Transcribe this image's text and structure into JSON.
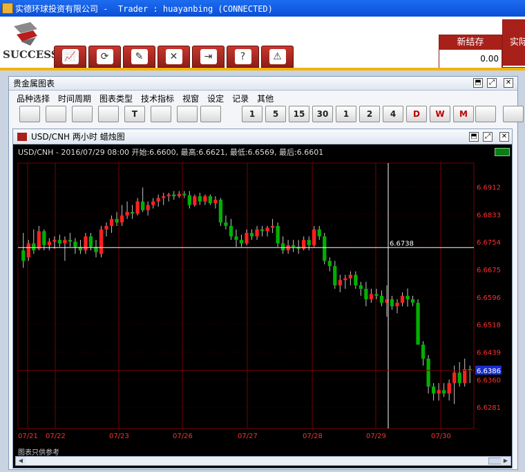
{
  "window": {
    "title": "实德环球投资有限公司 -  Trader : huayanbing (CONNECTED)"
  },
  "logo": {
    "text": "SUCCESS"
  },
  "top_toolbar": [
    {
      "icon": "chart-icon"
    },
    {
      "icon": "refresh-icon"
    },
    {
      "icon": "order-icon"
    },
    {
      "icon": "tools-icon"
    },
    {
      "icon": "logout-icon"
    },
    {
      "icon": "help-icon"
    },
    {
      "icon": "alert-icon"
    }
  ],
  "stats": [
    {
      "label": "新结存",
      "value": "0.00"
    },
    {
      "label": "实际",
      "value": ""
    }
  ],
  "outer_panel": {
    "title": "贵金属图表"
  },
  "menu": [
    "品种选择",
    "时间周期",
    "图表类型",
    "技术指标",
    "视窗",
    "设定",
    "记录",
    "其他"
  ],
  "chart_toolbar": [
    "",
    "",
    "",
    "",
    "T",
    "",
    "",
    "",
    "1",
    "5",
    "15",
    "30",
    "1",
    "2",
    "4",
    "D",
    "W",
    "M",
    "",
    ""
  ],
  "inner_panel": {
    "title": "USD/CNH 两小时 蜡烛图"
  },
  "info_line": "USD/CNH - 2016/07/29 08:00 开始:6.6600, 最高:6.6621, 最低:6.6569, 最后:6.6601",
  "footer": "图表只供参考",
  "chart_data": {
    "type": "candlestick",
    "symbol": "USD/CNH",
    "interval": "两小时",
    "x_labels": [
      "07/21",
      "07/22",
      "07/23",
      "07/26",
      "07/27",
      "07/28",
      "07/29",
      "07/30"
    ],
    "y_ticks": [
      "6.6912",
      "6.6833",
      "6.6754",
      "6.6675",
      "6.6596",
      "6.6518",
      "6.6439",
      "6.6360",
      "6.6281"
    ],
    "ylim": [
      6.622,
      6.698
    ],
    "crosshair_value": "6.6738",
    "last_price": "6.6386",
    "colors": {
      "up": "#ff2020",
      "down": "#00b000",
      "background": "#000000",
      "grid": "#7a0000",
      "axis_text": "#ff3030"
    },
    "candles": [
      {
        "o": 6.673,
        "h": 6.678,
        "l": 6.668,
        "c": 6.67
      },
      {
        "o": 6.671,
        "h": 6.676,
        "l": 6.67,
        "c": 6.675
      },
      {
        "o": 6.675,
        "h": 6.679,
        "l": 6.672,
        "c": 6.673
      },
      {
        "o": 6.6735,
        "h": 6.68,
        "l": 6.673,
        "c": 6.6785
      },
      {
        "o": 6.6785,
        "h": 6.679,
        "l": 6.673,
        "c": 6.6745
      },
      {
        "o": 6.6745,
        "h": 6.6765,
        "l": 6.673,
        "c": 6.6755
      },
      {
        "o": 6.6755,
        "h": 6.677,
        "l": 6.6735,
        "c": 6.676
      },
      {
        "o": 6.676,
        "h": 6.6775,
        "l": 6.674,
        "c": 6.675
      },
      {
        "o": 6.675,
        "h": 6.677,
        "l": 6.67,
        "c": 6.676
      },
      {
        "o": 6.676,
        "h": 6.678,
        "l": 6.674,
        "c": 6.6755
      },
      {
        "o": 6.6755,
        "h": 6.6765,
        "l": 6.672,
        "c": 6.674
      },
      {
        "o": 6.674,
        "h": 6.676,
        "l": 6.672,
        "c": 6.673
      },
      {
        "o": 6.673,
        "h": 6.678,
        "l": 6.672,
        "c": 6.677
      },
      {
        "o": 6.677,
        "h": 6.678,
        "l": 6.673,
        "c": 6.674
      },
      {
        "o": 6.674,
        "h": 6.676,
        "l": 6.671,
        "c": 6.6725
      },
      {
        "o": 6.672,
        "h": 6.68,
        "l": 6.671,
        "c": 6.679
      },
      {
        "o": 6.679,
        "h": 6.681,
        "l": 6.677,
        "c": 6.68
      },
      {
        "o": 6.68,
        "h": 6.683,
        "l": 6.678,
        "c": 6.682
      },
      {
        "o": 6.682,
        "h": 6.684,
        "l": 6.68,
        "c": 6.681
      },
      {
        "o": 6.681,
        "h": 6.686,
        "l": 6.68,
        "c": 6.683
      },
      {
        "o": 6.683,
        "h": 6.687,
        "l": 6.682,
        "c": 6.684
      },
      {
        "o": 6.684,
        "h": 6.686,
        "l": 6.682,
        "c": 6.6835
      },
      {
        "o": 6.6835,
        "h": 6.688,
        "l": 6.683,
        "c": 6.687
      },
      {
        "o": 6.687,
        "h": 6.691,
        "l": 6.684,
        "c": 6.6845
      },
      {
        "o": 6.6845,
        "h": 6.687,
        "l": 6.683,
        "c": 6.686
      },
      {
        "o": 6.686,
        "h": 6.688,
        "l": 6.685,
        "c": 6.687
      },
      {
        "o": 6.687,
        "h": 6.689,
        "l": 6.6855,
        "c": 6.688
      },
      {
        "o": 6.688,
        "h": 6.6895,
        "l": 6.686,
        "c": 6.6885
      },
      {
        "o": 6.6885,
        "h": 6.6895,
        "l": 6.687,
        "c": 6.689
      },
      {
        "o": 6.689,
        "h": 6.69,
        "l": 6.6875,
        "c": 6.6885
      },
      {
        "o": 6.6885,
        "h": 6.69,
        "l": 6.688,
        "c": 6.6892
      },
      {
        "o": 6.6892,
        "h": 6.69,
        "l": 6.688,
        "c": 6.6888
      },
      {
        "o": 6.6888,
        "h": 6.69,
        "l": 6.685,
        "c": 6.686
      },
      {
        "o": 6.686,
        "h": 6.689,
        "l": 6.6855,
        "c": 6.6885
      },
      {
        "o": 6.6885,
        "h": 6.6895,
        "l": 6.686,
        "c": 6.687
      },
      {
        "o": 6.687,
        "h": 6.689,
        "l": 6.686,
        "c": 6.6885
      },
      {
        "o": 6.6885,
        "h": 6.689,
        "l": 6.686,
        "c": 6.6865
      },
      {
        "o": 6.6865,
        "h": 6.6885,
        "l": 6.685,
        "c": 6.6875
      },
      {
        "o": 6.6875,
        "h": 6.688,
        "l": 6.68,
        "c": 6.681
      },
      {
        "o": 6.681,
        "h": 6.683,
        "l": 6.679,
        "c": 6.68
      },
      {
        "o": 6.68,
        "h": 6.682,
        "l": 6.676,
        "c": 6.677
      },
      {
        "o": 6.677,
        "h": 6.679,
        "l": 6.674,
        "c": 6.676
      },
      {
        "o": 6.676,
        "h": 6.6775,
        "l": 6.674,
        "c": 6.675
      },
      {
        "o": 6.675,
        "h": 6.679,
        "l": 6.6745,
        "c": 6.678
      },
      {
        "o": 6.678,
        "h": 6.679,
        "l": 6.676,
        "c": 6.677
      },
      {
        "o": 6.677,
        "h": 6.68,
        "l": 6.676,
        "c": 6.679
      },
      {
        "o": 6.679,
        "h": 6.68,
        "l": 6.677,
        "c": 6.6785
      },
      {
        "o": 6.6785,
        "h": 6.68,
        "l": 6.677,
        "c": 6.6795
      },
      {
        "o": 6.6795,
        "h": 6.682,
        "l": 6.678,
        "c": 6.68
      },
      {
        "o": 6.68,
        "h": 6.681,
        "l": 6.674,
        "c": 6.675
      },
      {
        "o": 6.675,
        "h": 6.677,
        "l": 6.672,
        "c": 6.673
      },
      {
        "o": 6.673,
        "h": 6.676,
        "l": 6.672,
        "c": 6.6745
      },
      {
        "o": 6.6745,
        "h": 6.676,
        "l": 6.6725,
        "c": 6.674
      },
      {
        "o": 6.674,
        "h": 6.676,
        "l": 6.672,
        "c": 6.6735
      },
      {
        "o": 6.6735,
        "h": 6.677,
        "l": 6.673,
        "c": 6.676
      },
      {
        "o": 6.676,
        "h": 6.677,
        "l": 6.673,
        "c": 6.6745
      },
      {
        "o": 6.6745,
        "h": 6.68,
        "l": 6.674,
        "c": 6.679
      },
      {
        "o": 6.679,
        "h": 6.68,
        "l": 6.676,
        "c": 6.677
      },
      {
        "o": 6.677,
        "h": 6.678,
        "l": 6.669,
        "c": 6.67
      },
      {
        "o": 6.67,
        "h": 6.671,
        "l": 6.667,
        "c": 6.6685
      },
      {
        "o": 6.6685,
        "h": 6.67,
        "l": 6.662,
        "c": 6.663
      },
      {
        "o": 6.663,
        "h": 6.666,
        "l": 6.661,
        "c": 6.6645
      },
      {
        "o": 6.6645,
        "h": 6.666,
        "l": 6.662,
        "c": 6.665
      },
      {
        "o": 6.665,
        "h": 6.667,
        "l": 6.663,
        "c": 6.666
      },
      {
        "o": 6.666,
        "h": 6.667,
        "l": 6.662,
        "c": 6.663
      },
      {
        "o": 6.663,
        "h": 6.664,
        "l": 6.66,
        "c": 6.662
      },
      {
        "o": 6.662,
        "h": 6.664,
        "l": 6.657,
        "c": 6.659
      },
      {
        "o": 6.659,
        "h": 6.662,
        "l": 6.658,
        "c": 6.6605
      },
      {
        "o": 6.6605,
        "h": 6.662,
        "l": 6.659,
        "c": 6.66
      },
      {
        "o": 6.66,
        "h": 6.6615,
        "l": 6.657,
        "c": 6.658
      },
      {
        "o": 6.658,
        "h": 6.663,
        "l": 6.654,
        "c": 6.659
      },
      {
        "o": 6.659,
        "h": 6.66,
        "l": 6.656,
        "c": 6.657
      },
      {
        "o": 6.657,
        "h": 6.659,
        "l": 6.655,
        "c": 6.658
      },
      {
        "o": 6.658,
        "h": 6.661,
        "l": 6.657,
        "c": 6.66
      },
      {
        "o": 6.66,
        "h": 6.6621,
        "l": 6.6569,
        "c": 6.659
      },
      {
        "o": 6.659,
        "h": 6.66,
        "l": 6.657,
        "c": 6.658
      },
      {
        "o": 6.658,
        "h": 6.659,
        "l": 6.648,
        "c": 6.646
      },
      {
        "o": 6.646,
        "h": 6.647,
        "l": 6.64,
        "c": 6.642
      },
      {
        "o": 6.642,
        "h": 6.643,
        "l": 6.632,
        "c": 6.634
      },
      {
        "o": 6.634,
        "h": 6.635,
        "l": 6.63,
        "c": 6.632
      },
      {
        "o": 6.632,
        "h": 6.635,
        "l": 6.63,
        "c": 6.633
      },
      {
        "o": 6.633,
        "h": 6.635,
        "l": 6.631,
        "c": 6.632
      },
      {
        "o": 6.632,
        "h": 6.636,
        "l": 6.63,
        "c": 6.635
      },
      {
        "o": 6.635,
        "h": 6.64,
        "l": 6.629,
        "c": 6.638
      },
      {
        "o": 6.638,
        "h": 6.641,
        "l": 6.634,
        "c": 6.635
      },
      {
        "o": 6.635,
        "h": 6.642,
        "l": 6.634,
        "c": 6.639
      },
      {
        "o": 6.639,
        "h": 6.64,
        "l": 6.635,
        "c": 6.6386
      }
    ]
  }
}
